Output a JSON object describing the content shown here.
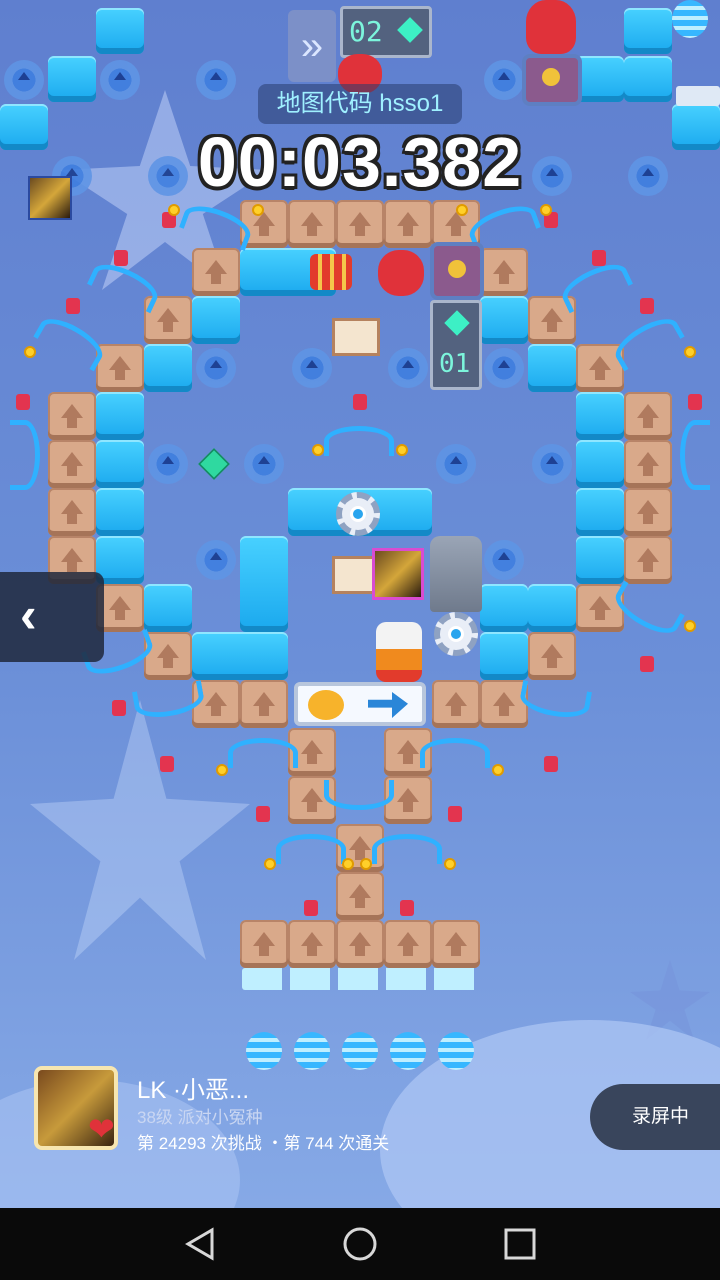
{
  "game": {
    "map_code_label": "地图代码 hsso1",
    "timer": "00:03.382",
    "counter_display": "01",
    "top_counter_display": "02"
  },
  "player": {
    "name": "LK ·小恶...",
    "level": "38级 派对小冤种",
    "stats": "第 24293 次挑战 ・第 744 次通关"
  },
  "controls": {
    "back_icon": "chevron-left-icon",
    "recording_label": "录屏中"
  },
  "system_nav": {
    "back": "nav-back-icon",
    "home": "nav-home-icon",
    "recents": "nav-recents-icon"
  },
  "colors": {
    "background": "#6b8fd8",
    "ice_block": "#2ab8f5",
    "wood_block": "#d9a98a",
    "crossbow": "#2fb1ff",
    "timer_text": "#ffffff",
    "map_code_text": "#9ff0ff"
  }
}
